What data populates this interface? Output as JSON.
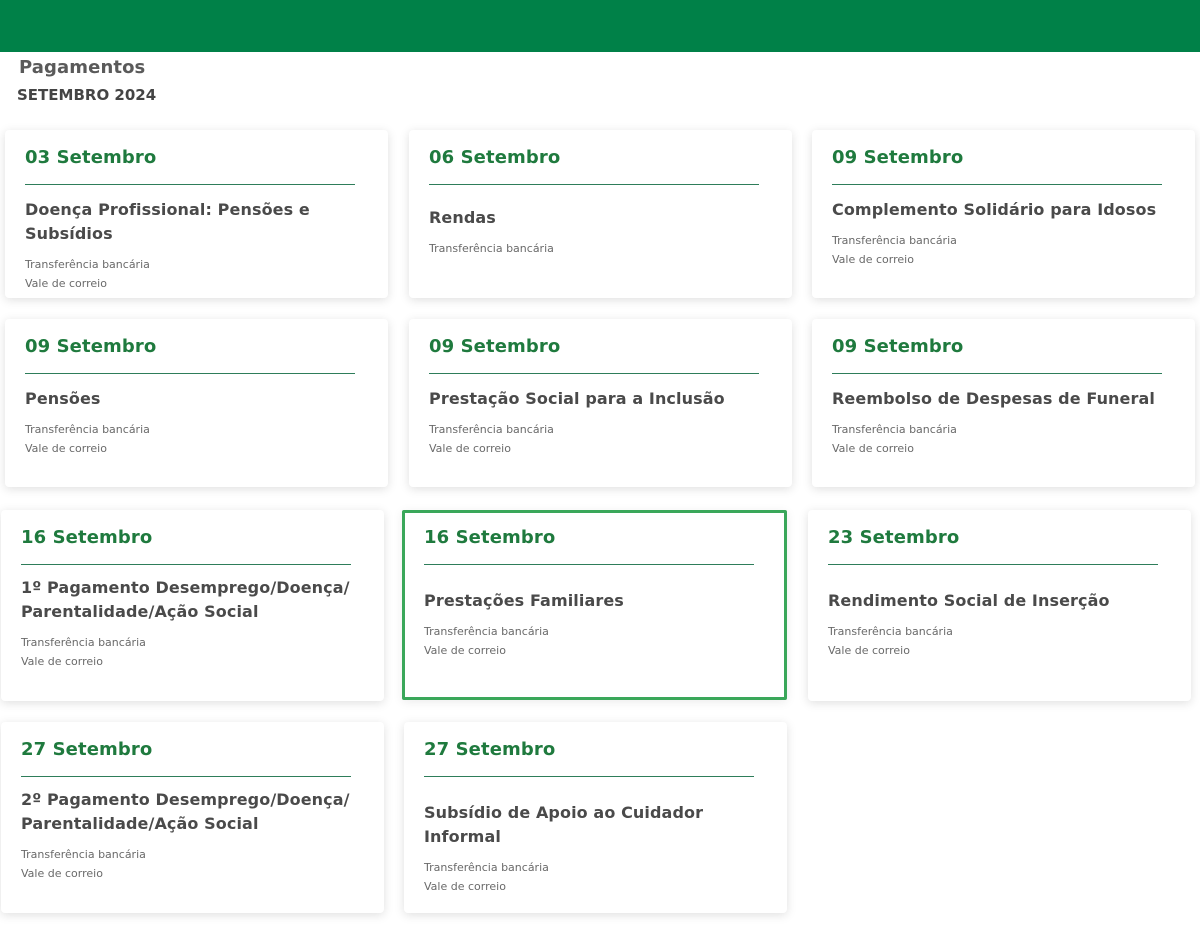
{
  "header": {
    "title": "Pagamentos",
    "subtitle": "SETEMBRO 2024"
  },
  "cards": [
    {
      "date": "03 Setembro",
      "title": "Doença Profissional: Pensões e Subsídios",
      "methods": [
        "Transferência bancária",
        "Vale de correio"
      ]
    },
    {
      "date": "06 Setembro",
      "title": "Rendas",
      "methods": [
        "Transferência bancária"
      ]
    },
    {
      "date": "09 Setembro",
      "title": "Complemento Solidário para Idosos",
      "methods": [
        "Transferência bancária",
        "Vale de correio"
      ]
    },
    {
      "date": "09 Setembro",
      "title": "Pensões",
      "methods": [
        "Transferência bancária",
        "Vale de correio"
      ]
    },
    {
      "date": "09 Setembro",
      "title": "Prestação Social para a Inclusão",
      "methods": [
        "Transferência bancária",
        "Vale de correio"
      ]
    },
    {
      "date": "09 Setembro",
      "title": "Reembolso de Despesas de Funeral",
      "methods": [
        "Transferência bancária",
        "Vale de correio"
      ]
    },
    {
      "date": "16 Setembro",
      "title": "1º Pagamento Desemprego/Doença/ Parentalidade/Ação Social",
      "methods": [
        "Transferência bancária",
        "Vale de correio"
      ]
    },
    {
      "date": "16 Setembro",
      "title": "Prestações Familiares",
      "methods": [
        "Transferência bancária",
        "Vale de correio"
      ]
    },
    {
      "date": "23 Setembro",
      "title": "Rendimento Social de Inserção",
      "methods": [
        "Transferência bancária",
        "Vale de correio"
      ]
    },
    {
      "date": "27 Setembro",
      "title": "2º Pagamento Desemprego/Doença/ Parentalidade/Ação Social",
      "methods": [
        "Transferência bancária",
        "Vale de correio"
      ]
    },
    {
      "date": "27 Setembro",
      "title": "Subsídio de Apoio ao Cuidador Informal",
      "methods": [
        "Transferência bancária",
        "Vale de correio"
      ]
    }
  ],
  "colors": {
    "brand": "#008148",
    "date": "#1f7a3e",
    "highlight_border": "#3aa75a"
  }
}
